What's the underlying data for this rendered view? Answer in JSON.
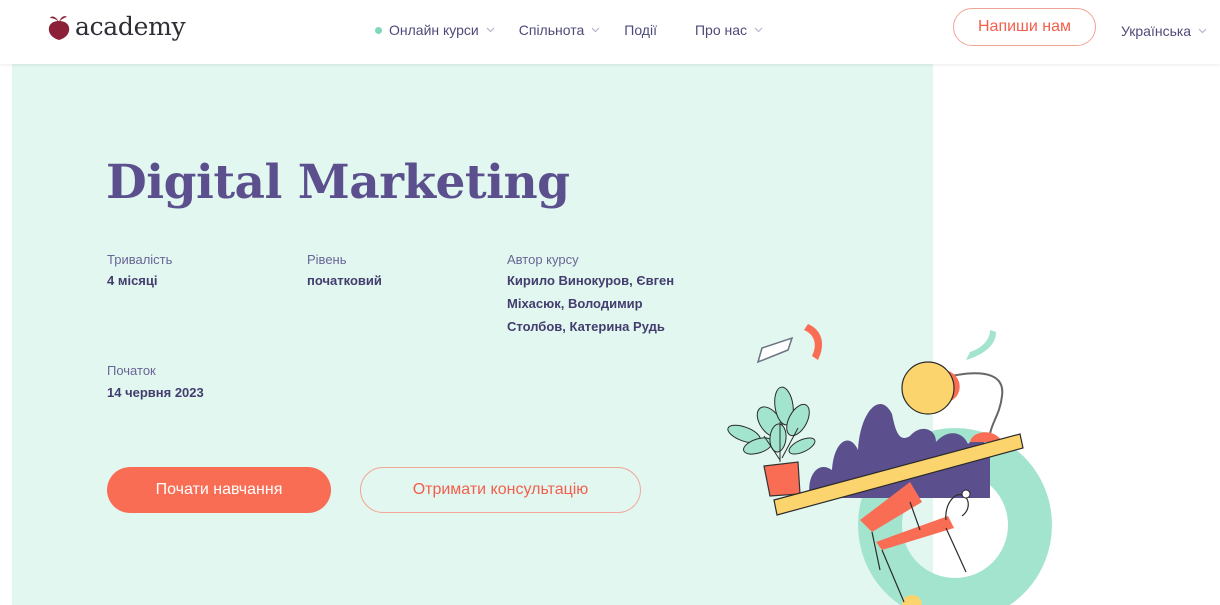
{
  "header": {
    "logo_text": "academy",
    "nav": [
      {
        "label": "Онлайн курси",
        "has_dot": true,
        "has_chevron": true
      },
      {
        "label": "Спільнота",
        "has_dot": false,
        "has_chevron": true
      },
      {
        "label": "Події",
        "has_dot": false,
        "has_chevron": false
      },
      {
        "label": "Про нас",
        "has_dot": false,
        "has_chevron": true
      }
    ],
    "cta_label": "Напиши нам",
    "language": "Українська"
  },
  "hero": {
    "title": "Digital Marketing",
    "duration": {
      "label": "Тривалість",
      "value": "4 місяці"
    },
    "level": {
      "label": "Рівень",
      "value": "початковий"
    },
    "author": {
      "label": "Автор курсу",
      "lines": [
        "Кирило Винокуров, Євген",
        "Міхасюк, Володимир",
        "Столбов, Катерина Рудь"
      ]
    },
    "start": {
      "label": "Початок",
      "value": "14 червня 2023"
    },
    "primary_button": "Почати навчання",
    "secondary_button": "Отримати консультацію"
  },
  "colors": {
    "accent": "#f96d54",
    "hero_bg": "#e2f7f0",
    "text_primary": "#5b4f8e",
    "mint": "#a3e4cf",
    "yellow": "#fbd46d"
  },
  "icons": [
    "beet-logo-icon",
    "chevron-down-icon"
  ]
}
